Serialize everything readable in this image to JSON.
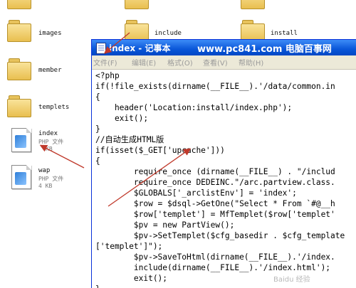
{
  "explorer": {
    "folders": [
      {
        "name": "images"
      },
      {
        "name": "member"
      },
      {
        "name": "templets"
      },
      {
        "name": "include"
      },
      {
        "name": "install"
      }
    ],
    "files": [
      {
        "name": "index",
        "type": "PHP 文件",
        "size": "KB"
      },
      {
        "name": "wap",
        "type": "PHP 文件",
        "size": "4 KB"
      }
    ]
  },
  "notepad": {
    "title": "index - 记事本",
    "watermark": "www.pc841.com 电脑百事网",
    "menu": [
      "文件(F)",
      "编辑(E)",
      "格式(O)",
      "查看(V)",
      "帮助(H)"
    ],
    "code_lines": [
      "<?php",
      "if(!file_exists(dirname(__FILE__).'/data/common.in",
      "{",
      "    header('Location:install/index.php');",
      "    exit();",
      "}",
      "//自动生成HTML版",
      "if(isset($_GET['upcache']))",
      "{",
      "        require_once (dirname(__FILE__) . \"/includ",
      "        require_once DEDEINC.\"/arc.partview.class.",
      "        $GLOBALS['_arclistEnv'] = 'index';",
      "        $row = $dsql->GetOne(\"Select * From `#@__h",
      "        $row['templet'] = MfTemplet($row['templet'",
      "        $pv = new PartView();",
      "        $pv->SetTemplet($cfg_basedir . $cfg_template",
      "['templet']\");",
      "        $pv->SaveToHtml(dirname(__FILE__).'/index.",
      "        include(dirname(__FILE__).'/index.html');",
      "        exit();",
      "}"
    ]
  },
  "bottom_watermark": "Baidu 经验",
  "colors": {
    "titlebar": "#0a56d8",
    "arrow": "#c0392b"
  }
}
